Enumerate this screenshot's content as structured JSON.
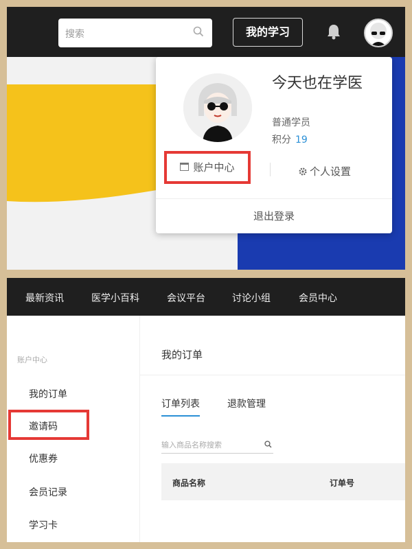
{
  "top": {
    "search_placeholder": "搜索",
    "my_study": "我的学习",
    "dropdown": {
      "name": "今天也在学医",
      "role": "普通学员",
      "points_label": "积分",
      "points_value": "19",
      "account_center": "账户中心",
      "settings": "个人设置",
      "logout": "退出登录"
    }
  },
  "bottom": {
    "nav": [
      "最新资讯",
      "医学小百科",
      "会议平台",
      "讨论小组",
      "会员中心"
    ],
    "sidebar": {
      "header": "账户中心",
      "items": [
        "我的订单",
        "邀请码",
        "优惠券",
        "会员记录",
        "学习卡"
      ]
    },
    "main": {
      "title": "我的订单",
      "tabs": [
        "订单列表",
        "退款管理"
      ],
      "search_placeholder": "输入商品名称搜索",
      "columns": [
        "商品名称",
        "订单号"
      ]
    }
  },
  "colors": {
    "highlight": "#e53935",
    "accent": "#2a8fd6",
    "banner_blue": "#1a3bb0",
    "banner_yellow": "#f5c21b"
  }
}
